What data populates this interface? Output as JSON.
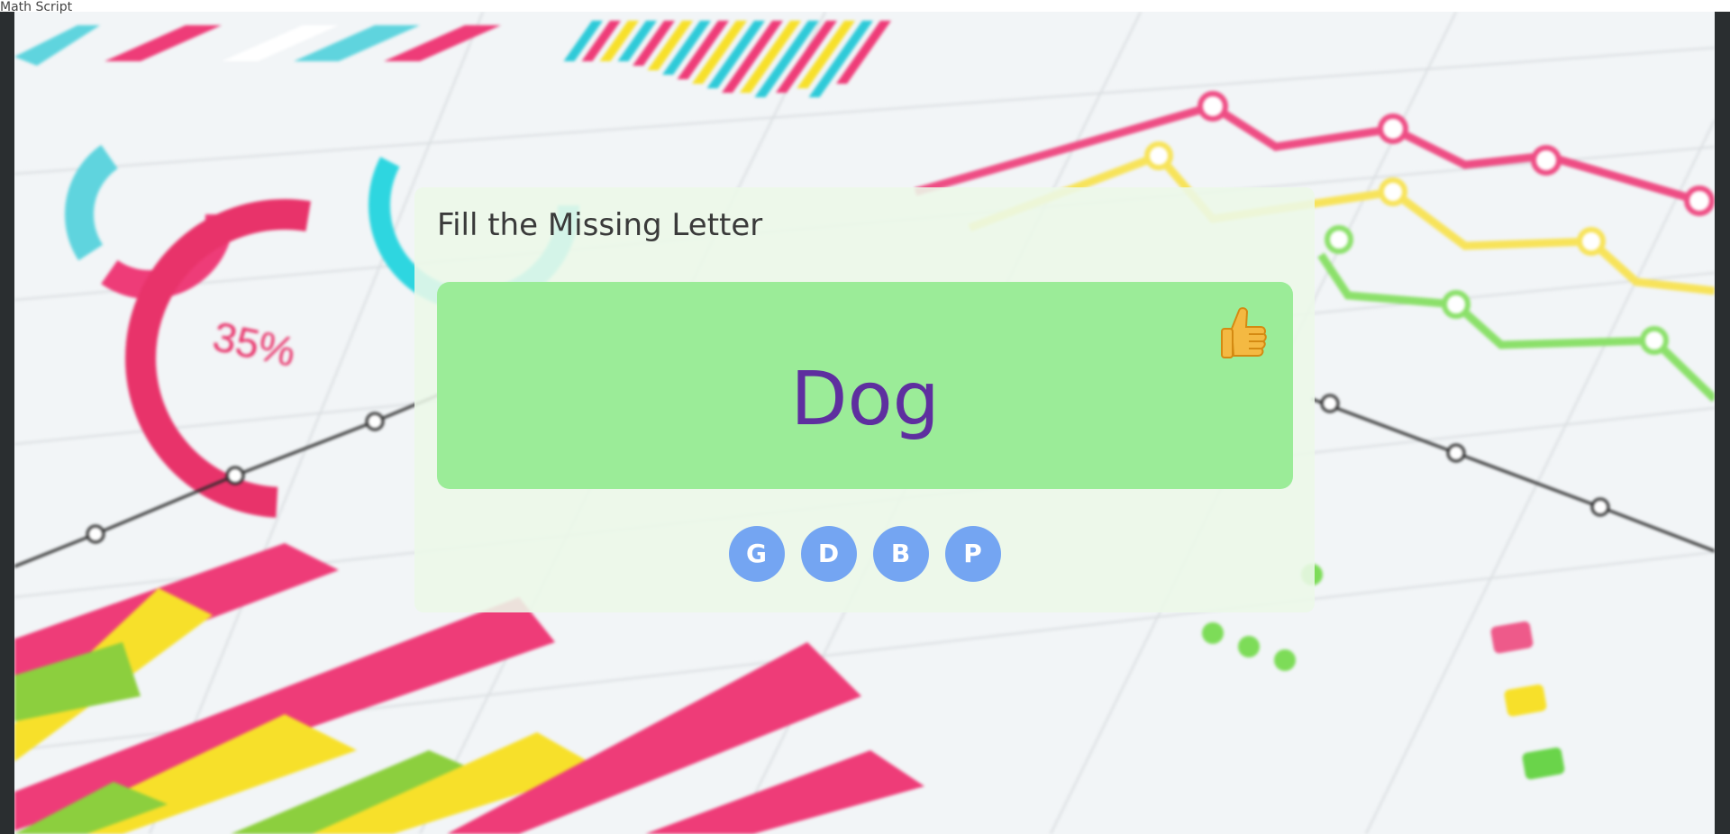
{
  "topbar": {
    "text": "Math Script"
  },
  "game": {
    "title": "Fill the Missing Letter",
    "word": "Dog",
    "feedback_icon": "thumbs-up-icon",
    "options": [
      "G",
      "D",
      "B",
      "P"
    ]
  },
  "colors": {
    "panel": "#9bec98",
    "word": "#5e2f9f",
    "option_button": "#74a5f2"
  }
}
